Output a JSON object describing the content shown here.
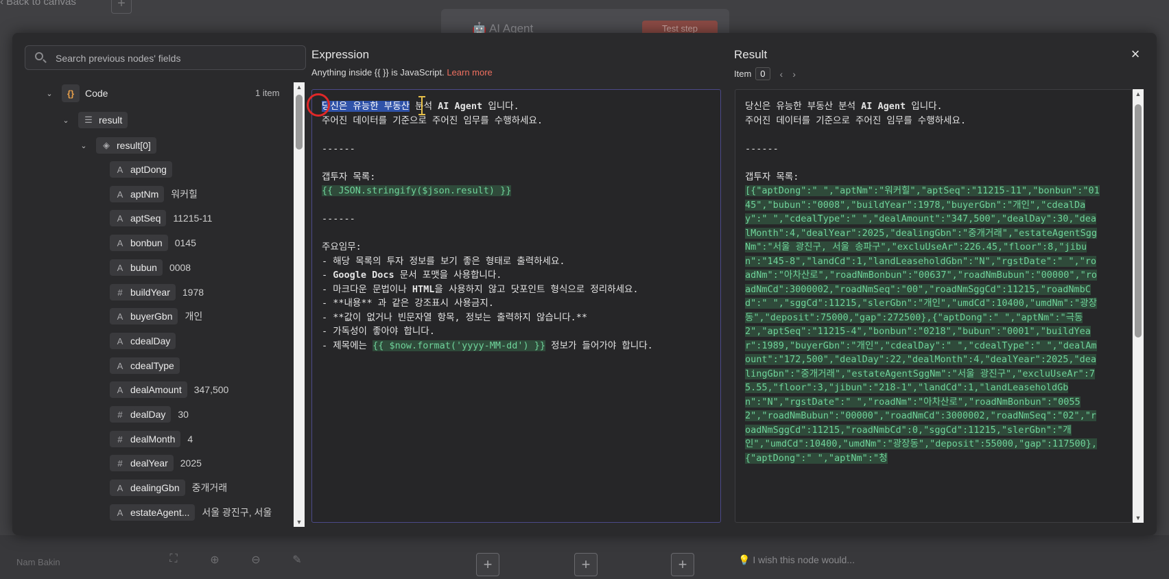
{
  "background": {
    "back_link": "Back to canvas",
    "node_title": "AI Agent",
    "test_step": "Test step",
    "wish_placeholder": "I wish this node would...",
    "name_badge": "Nam Bakin"
  },
  "left_panel": {
    "search_placeholder": "Search previous nodes' fields",
    "node": {
      "label": "Code",
      "count": "1 item"
    },
    "result_label": "result",
    "result0_label": "result[0]",
    "fields": [
      {
        "type": "A",
        "name": "aptDong",
        "value": ""
      },
      {
        "type": "A",
        "name": "aptNm",
        "value": "워커힐"
      },
      {
        "type": "A",
        "name": "aptSeq",
        "value": "11215-11"
      },
      {
        "type": "A",
        "name": "bonbun",
        "value": "0145"
      },
      {
        "type": "A",
        "name": "bubun",
        "value": "0008"
      },
      {
        "type": "#",
        "name": "buildYear",
        "value": "1978"
      },
      {
        "type": "A",
        "name": "buyerGbn",
        "value": "개인"
      },
      {
        "type": "A",
        "name": "cdealDay",
        "value": ""
      },
      {
        "type": "A",
        "name": "cdealType",
        "value": ""
      },
      {
        "type": "A",
        "name": "dealAmount",
        "value": "347,500"
      },
      {
        "type": "#",
        "name": "dealDay",
        "value": "30"
      },
      {
        "type": "#",
        "name": "dealMonth",
        "value": "4"
      },
      {
        "type": "#",
        "name": "dealYear",
        "value": "2025"
      },
      {
        "type": "A",
        "name": "dealingGbn",
        "value": "중개거래"
      },
      {
        "type": "A",
        "name": "estateAgent...",
        "value": "서울 광진구, 서울"
      }
    ]
  },
  "expression": {
    "title": "Expression",
    "hint_prefix": "Anything inside {{ }} is JavaScript.",
    "learn_more": "Learn more",
    "line1_selected": "당신은 유능한 부동산",
    "line1_rest_a": " 분석 ",
    "line1_bold": "AI Agent",
    "line1_rest_b": " 입니다.",
    "line2": "주어진 데이터를 기준으로 주어진 임무를 수행하세요.",
    "sep1": "------",
    "list_title": "갭투자 목록:",
    "expr1": "{{ JSON.stringify($json.result) }}",
    "sep2": "------",
    "task_title": "주요임무:",
    "task1": "- 해당 목록의 투자 정보를 보기 좋은 형태로 출력하세요.",
    "task2_bold": "Google Docs",
    "task2_rest": " 문서 포맷을 사용합니다.",
    "task3_a": "- 마크다운 문법이나 ",
    "task3_bold": "HTML",
    "task3_b": "을 사용하지 않고 닷포인트 형식으로 정리하세요.",
    "task4": "- **내용** 과 같은 강조표시 사용금지.",
    "task5": "- **값이 없거나 빈문자열 항목, 정보는 출력하지 않습니다.**",
    "task6": "- 가독성이 좋아야 합니다.",
    "task7_a": "- 제목에는 ",
    "task7_expr": "{{ $now.format('yyyy-MM-dd') }}",
    "task7_b": " 정보가 들어가야 합니다."
  },
  "result": {
    "title": "Result",
    "item_label": "Item",
    "item_index": "0",
    "line1_a": "당신은 유능한 부동산 분석 ",
    "line1_bold": "AI Agent",
    "line1_b": " 입니다.",
    "line2": "주어진 데이터를 기준으로 주어진 임무를 수행하세요.",
    "sep": "------",
    "list_title": "갭투자 목록:",
    "json_text": "[{\"aptDong\":\" \",\"aptNm\":\"워커힐\",\"aptSeq\":\"11215-11\",\"bonbun\":\"0145\",\"bubun\":\"0008\",\"buildYear\":1978,\"buyerGbn\":\"개인\",\"cdealDay\":\" \",\"cdealType\":\" \",\"dealAmount\":\"347,500\",\"dealDay\":30,\"dealMonth\":4,\"dealYear\":2025,\"dealingGbn\":\"중개거래\",\"estateAgentSggNm\":\"서울 광진구, 서울 송파구\",\"excluUseAr\":226.45,\"floor\":8,\"jibun\":\"145-8\",\"landCd\":1,\"landLeaseholdGbn\":\"N\",\"rgstDate\":\" \",\"roadNm\":\"아차산로\",\"roadNmBonbun\":\"00637\",\"roadNmBubun\":\"00000\",\"roadNmCd\":3000002,\"roadNmSeq\":\"00\",\"roadNmSggCd\":11215,\"roadNmbCd\":\" \",\"sggCd\":11215,\"slerGbn\":\"개인\",\"umdCd\":10400,\"umdNm\":\"광장동\",\"deposit\":75000,\"gap\":272500},{\"aptDong\":\" \",\"aptNm\":\"극동2\",\"aptSeq\":\"11215-4\",\"bonbun\":\"0218\",\"bubun\":\"0001\",\"buildYear\":1989,\"buyerGbn\":\"개인\",\"cdealDay\":\" \",\"cdealType\":\" \",\"dealAmount\":\"172,500\",\"dealDay\":22,\"dealMonth\":4,\"dealYear\":2025,\"dealingGbn\":\"중개거래\",\"estateAgentSggNm\":\"서울 광진구\",\"excluUseAr\":75.55,\"floor\":3,\"jibun\":\"218-1\",\"landCd\":1,\"landLeaseholdGbn\":\"N\",\"rgstDate\":\" \",\"roadNm\":\"아차산로\",\"roadNmBonbun\":\"00552\",\"roadNmBubun\":\"00000\",\"roadNmCd\":3000002,\"roadNmSeq\":\"02\",\"roadNmSggCd\":11215,\"roadNmbCd\":0,\"sggCd\":11215,\"slerGbn\":\"개인\",\"umdCd\":10400,\"umdNm\":\"광장동\",\"deposit\":55000,\"gap\":117500},{\"aptDong\":\" \",\"aptNm\":\"청"
  }
}
